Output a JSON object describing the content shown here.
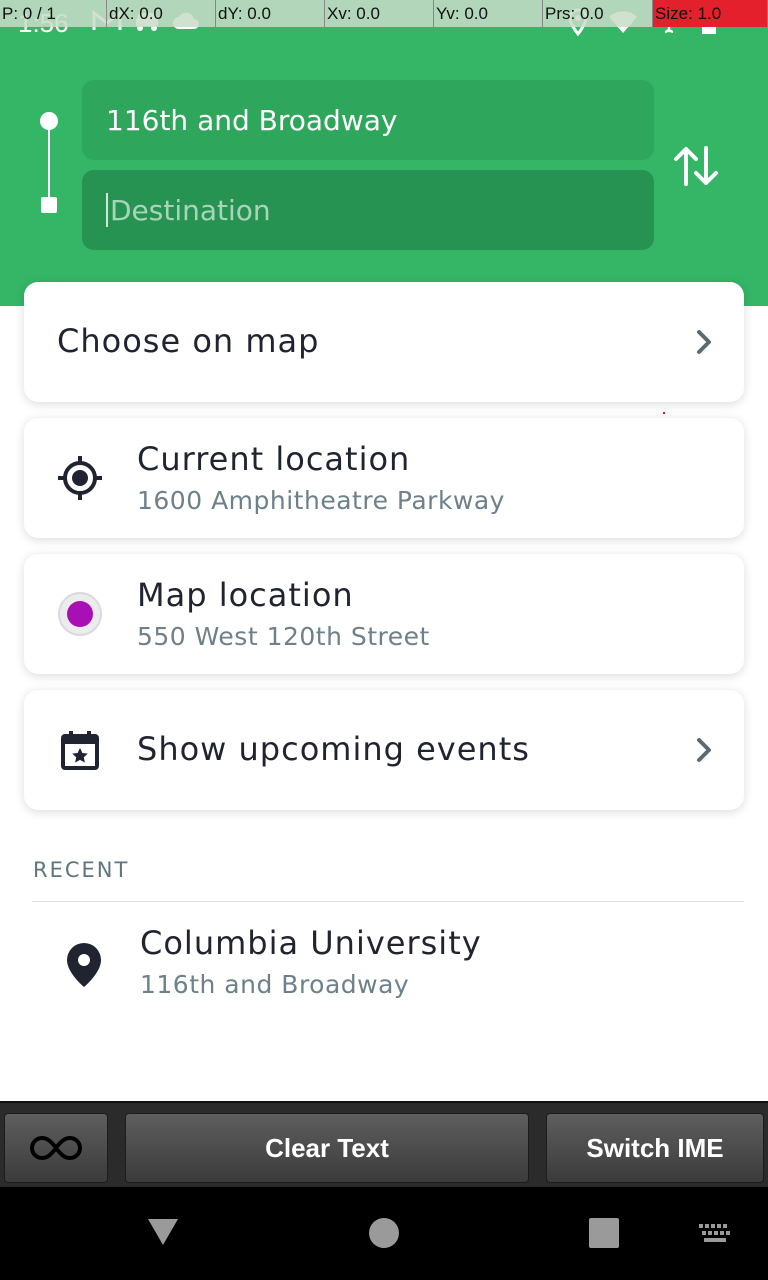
{
  "status_bar": {
    "time": "1:56",
    "icons": [
      "gmail-icon",
      "car-icon",
      "cloud-icon",
      "location-icon",
      "wifi-icon",
      "airplane-icon",
      "battery-icon"
    ]
  },
  "pointer_overlay": {
    "p": "P: 0 / 1",
    "dx": "dX: 0.0",
    "dy": "dY: 0.0",
    "xv": "Xv: 0.0",
    "yv": "Yv: 0.0",
    "prs": "Prs: 0.0",
    "size": "Size: 1.0"
  },
  "route": {
    "origin_value": "116th and Broadway",
    "destination_placeholder": "Destination"
  },
  "options": {
    "choose_on_map": "Choose on map",
    "current_location": {
      "title": "Current location",
      "subtitle": "1600 Amphitheatre Parkway"
    },
    "map_location": {
      "title": "Map location",
      "subtitle": "550 West 120th Street"
    },
    "upcoming_events": "Show upcoming events"
  },
  "recent": {
    "header": "RECENT",
    "items": [
      {
        "title": "Columbia University",
        "subtitle": "116th and Broadway"
      }
    ]
  },
  "ime_bar": {
    "clear_text": "Clear Text",
    "switch_ime": "Switch IME"
  },
  "colors": {
    "header_green": "#35b566",
    "accent_purple": "#a80fb4",
    "text_dark": "#1f2430",
    "text_muted": "#6e808a"
  }
}
